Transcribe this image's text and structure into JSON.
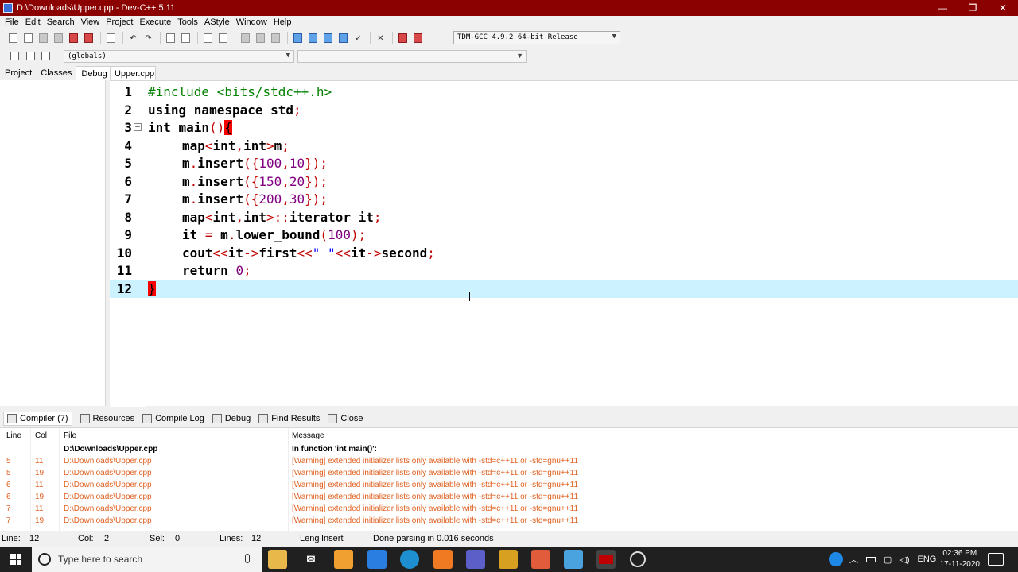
{
  "window": {
    "title": "D:\\Downloads\\Upper.cpp - Dev-C++ 5.11",
    "controls": {
      "minimize": "—",
      "restore": "❐",
      "close": "✕"
    }
  },
  "menu": [
    "File",
    "Edit",
    "Search",
    "View",
    "Project",
    "Execute",
    "Tools",
    "AStyle",
    "Window",
    "Help"
  ],
  "toolbar": {
    "compiler": "TDM-GCC 4.9.2 64-bit Release"
  },
  "scope": {
    "value": "(globals)",
    "function_value": ""
  },
  "left_tabs": [
    "Project",
    "Classes",
    "Debug"
  ],
  "editor_tab": "Upper.cpp",
  "code_lines": [
    {
      "n": "1"
    },
    {
      "n": "2"
    },
    {
      "n": "3"
    },
    {
      "n": "4"
    },
    {
      "n": "5"
    },
    {
      "n": "6"
    },
    {
      "n": "7"
    },
    {
      "n": "8"
    },
    {
      "n": "9"
    },
    {
      "n": "10"
    },
    {
      "n": "11"
    },
    {
      "n": "12"
    }
  ],
  "code": {
    "l1": "#include <bits/stdc++.h>",
    "l2a": "using namespace ",
    "l2b": "std",
    "l2c": ";",
    "l3a": "int ",
    "l3b": "main",
    "l3c": "()",
    "l3d": "{",
    "l4a": "map",
    "l4b": "<",
    "l4c": "int",
    "l4d": ",",
    "l4e": "int",
    "l4f": ">",
    "l4g": "m",
    "l4h": ";",
    "l5a": "m",
    "l5b": ".",
    "l5c": "insert",
    "l5d": "({",
    "l5e": "100",
    "l5f": ",",
    "l5g": "10",
    "l5h": "});",
    "l6a": "m",
    "l6b": ".",
    "l6c": "insert",
    "l6d": "({",
    "l6e": "150",
    "l6f": ",",
    "l6g": "20",
    "l6h": "});",
    "l7a": "m",
    "l7b": ".",
    "l7c": "insert",
    "l7d": "({",
    "l7e": "200",
    "l7f": ",",
    "l7g": "30",
    "l7h": "});",
    "l8a": "map",
    "l8b": "<",
    "l8c": "int",
    "l8d": ",",
    "l8e": "int",
    "l8f": ">::",
    "l8g": "iterator it",
    "l8h": ";",
    "l9a": "it ",
    "l9b": "=",
    "l9c": " m",
    "l9d": ".",
    "l9e": "lower_bound",
    "l9f": "(",
    "l9g": "100",
    "l9h": ");",
    "l10a": "cout",
    "l10b": "<<",
    "l10c": "it",
    "l10d": "->",
    "l10e": "first",
    "l10f": "<<",
    "l10g": "\" \"",
    "l10h": "<<",
    "l10i": "it",
    "l10j": "->",
    "l10k": "second",
    "l10l": ";",
    "l11a": "return ",
    "l11b": "0",
    "l11c": ";",
    "l12": "}"
  },
  "fold_marker": "−",
  "bottom_tabs": [
    {
      "label": "Compiler (7)"
    },
    {
      "label": "Resources"
    },
    {
      "label": "Compile Log"
    },
    {
      "label": "Debug"
    },
    {
      "label": "Find Results"
    },
    {
      "label": "Close"
    }
  ],
  "messages": {
    "headers": {
      "line": "Line",
      "col": "Col",
      "file": "File",
      "message": "Message"
    },
    "rows": [
      {
        "line": "",
        "col": "",
        "file": "D:\\Downloads\\Upper.cpp",
        "message": "In function 'int main()':",
        "kind": "bold"
      },
      {
        "line": "5",
        "col": "11",
        "file": "D:\\Downloads\\Upper.cpp",
        "message": "[Warning] extended initializer lists only available with -std=c++11 or -std=gnu++11",
        "kind": "warn"
      },
      {
        "line": "5",
        "col": "19",
        "file": "D:\\Downloads\\Upper.cpp",
        "message": "[Warning] extended initializer lists only available with -std=c++11 or -std=gnu++11",
        "kind": "warn"
      },
      {
        "line": "6",
        "col": "11",
        "file": "D:\\Downloads\\Upper.cpp",
        "message": "[Warning] extended initializer lists only available with -std=c++11 or -std=gnu++11",
        "kind": "warn"
      },
      {
        "line": "6",
        "col": "19",
        "file": "D:\\Downloads\\Upper.cpp",
        "message": "[Warning] extended initializer lists only available with -std=c++11 or -std=gnu++11",
        "kind": "warn"
      },
      {
        "line": "7",
        "col": "11",
        "file": "D:\\Downloads\\Upper.cpp",
        "message": "[Warning] extended initializer lists only available with -std=c++11 or -std=gnu++11",
        "kind": "warn"
      },
      {
        "line": "7",
        "col": "19",
        "file": "D:\\Downloads\\Upper.cpp",
        "message": "[Warning] extended initializer lists only available with -std=c++11 or -std=gnu++11",
        "kind": "warn"
      }
    ]
  },
  "status": {
    "line_label": "Line:",
    "line": "12",
    "col_label": "Col:",
    "col": "2",
    "sel_label": "Sel:",
    "sel": "0",
    "lines_label": "Lines:",
    "lines": "12",
    "length": "Leng",
    "mode": "Insert",
    "parse": "Done parsing in 0.016 seconds"
  },
  "taskbar": {
    "search_placeholder": "Type here to search",
    "lang": "ENG",
    "time": "02:36 PM",
    "date": "17-11-2020"
  },
  "colors": {
    "titlebar": "#8b0000",
    "current_line": "#ccf2ff",
    "warning_text": "#e06020",
    "brace_highlight": "#ff0000"
  }
}
